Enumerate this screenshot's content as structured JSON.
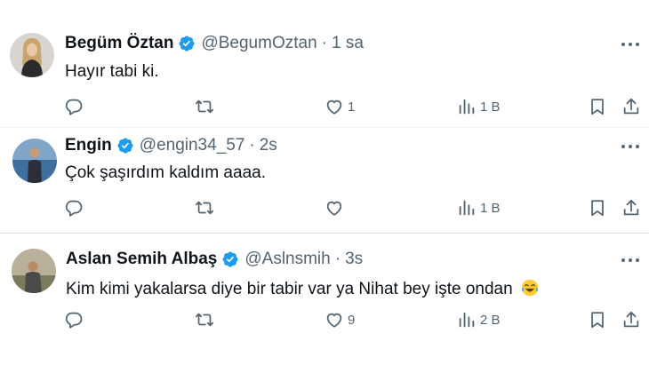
{
  "tweets": [
    {
      "name": "Begüm Öztan",
      "handle": "@BegumOztan",
      "separator": "·",
      "time": "1 sa",
      "text": "Hayır tabi ki.",
      "likes": "1",
      "views": "1 B",
      "replies": "",
      "retweets": ""
    },
    {
      "name": "Engin",
      "handle": "@engin34_57",
      "separator": "·",
      "time": "2s",
      "text": "Çok şaşırdım kaldım aaaa.",
      "likes": "",
      "views": "1 B",
      "replies": "",
      "retweets": ""
    },
    {
      "name": "Aslan Semih Albaş",
      "handle": "@Aslnsmih",
      "separator": "·",
      "time": "3s",
      "text": "Kim kimi yakalarsa diye bir tabir var ya Nihat bey işte ondan",
      "likes": "9",
      "views": "2 B",
      "replies": "",
      "retweets": "",
      "emoji": "face-with-tears-of-joy"
    }
  ],
  "colors": {
    "verified": "#1d9bf0",
    "muted": "#536471",
    "text": "#0f1419",
    "divider": "#eff3f4"
  }
}
